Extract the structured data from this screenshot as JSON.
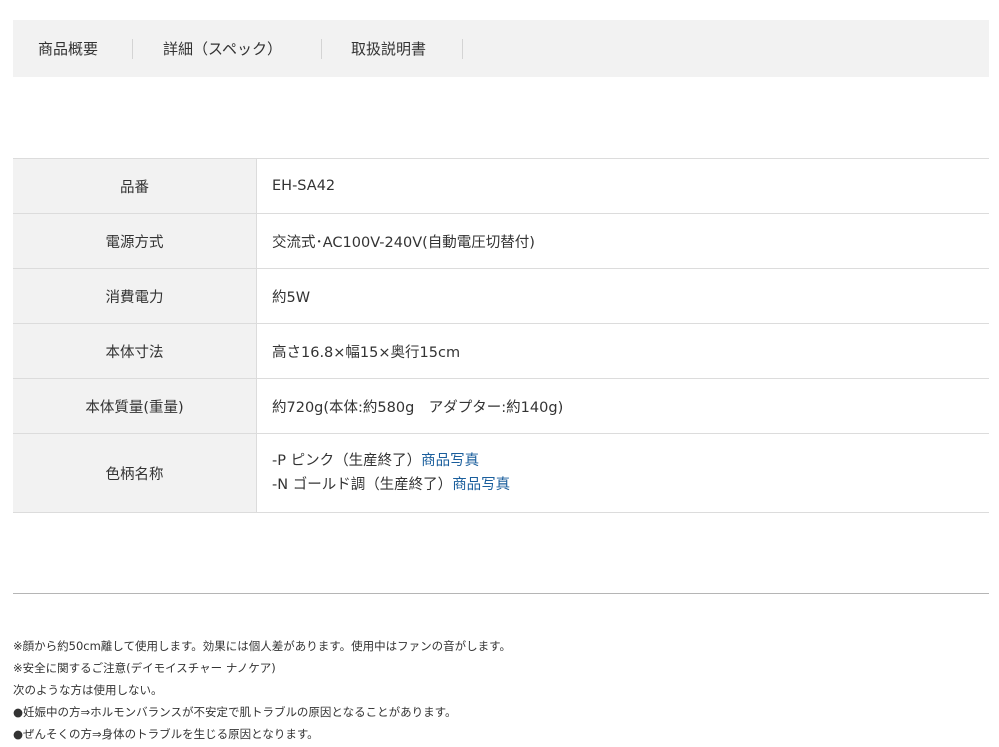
{
  "tabs": [
    {
      "label": "商品概要"
    },
    {
      "label": "詳細（スペック）"
    },
    {
      "label": "取扱説明書"
    }
  ],
  "spec": {
    "rows": [
      {
        "label": "品番",
        "value": "EH-SA42"
      },
      {
        "label": "電源方式",
        "value": "交流式･AC100V-240V(自動電圧切替付)"
      },
      {
        "label": "消費電力",
        "value": "約5W"
      },
      {
        "label": "本体寸法",
        "value": "高さ16.8×幅15×奥行15cm"
      },
      {
        "label": "本体質量(重量)",
        "value": "約720g(本体:約580g　アダプター:約140g)"
      }
    ],
    "color_row": {
      "label": "色柄名称",
      "items": [
        {
          "text": "-P ピンク（生産終了）",
          "link": "商品写真"
        },
        {
          "text": "-N ゴールド調（生産終了）",
          "link": "商品写真"
        }
      ]
    }
  },
  "notes": [
    "※顔から約50cm離して使用します。効果には個人差があります。使用中はファンの音がします。",
    "※安全に関するご注意(デイモイスチャー ナノケア)",
    "次のような方は使用しない。",
    "●妊娠中の方⇒ホルモンバランスが不安定で肌トラブルの原因となることがあります。",
    "●ぜんそくの方⇒身体のトラブルを生じる原因となります。"
  ],
  "colors": {
    "tab_bg": "#f2f2f2",
    "label_bg": "#f2f2f2",
    "link": "#1a5e9c",
    "border": "#dcdcdc"
  }
}
